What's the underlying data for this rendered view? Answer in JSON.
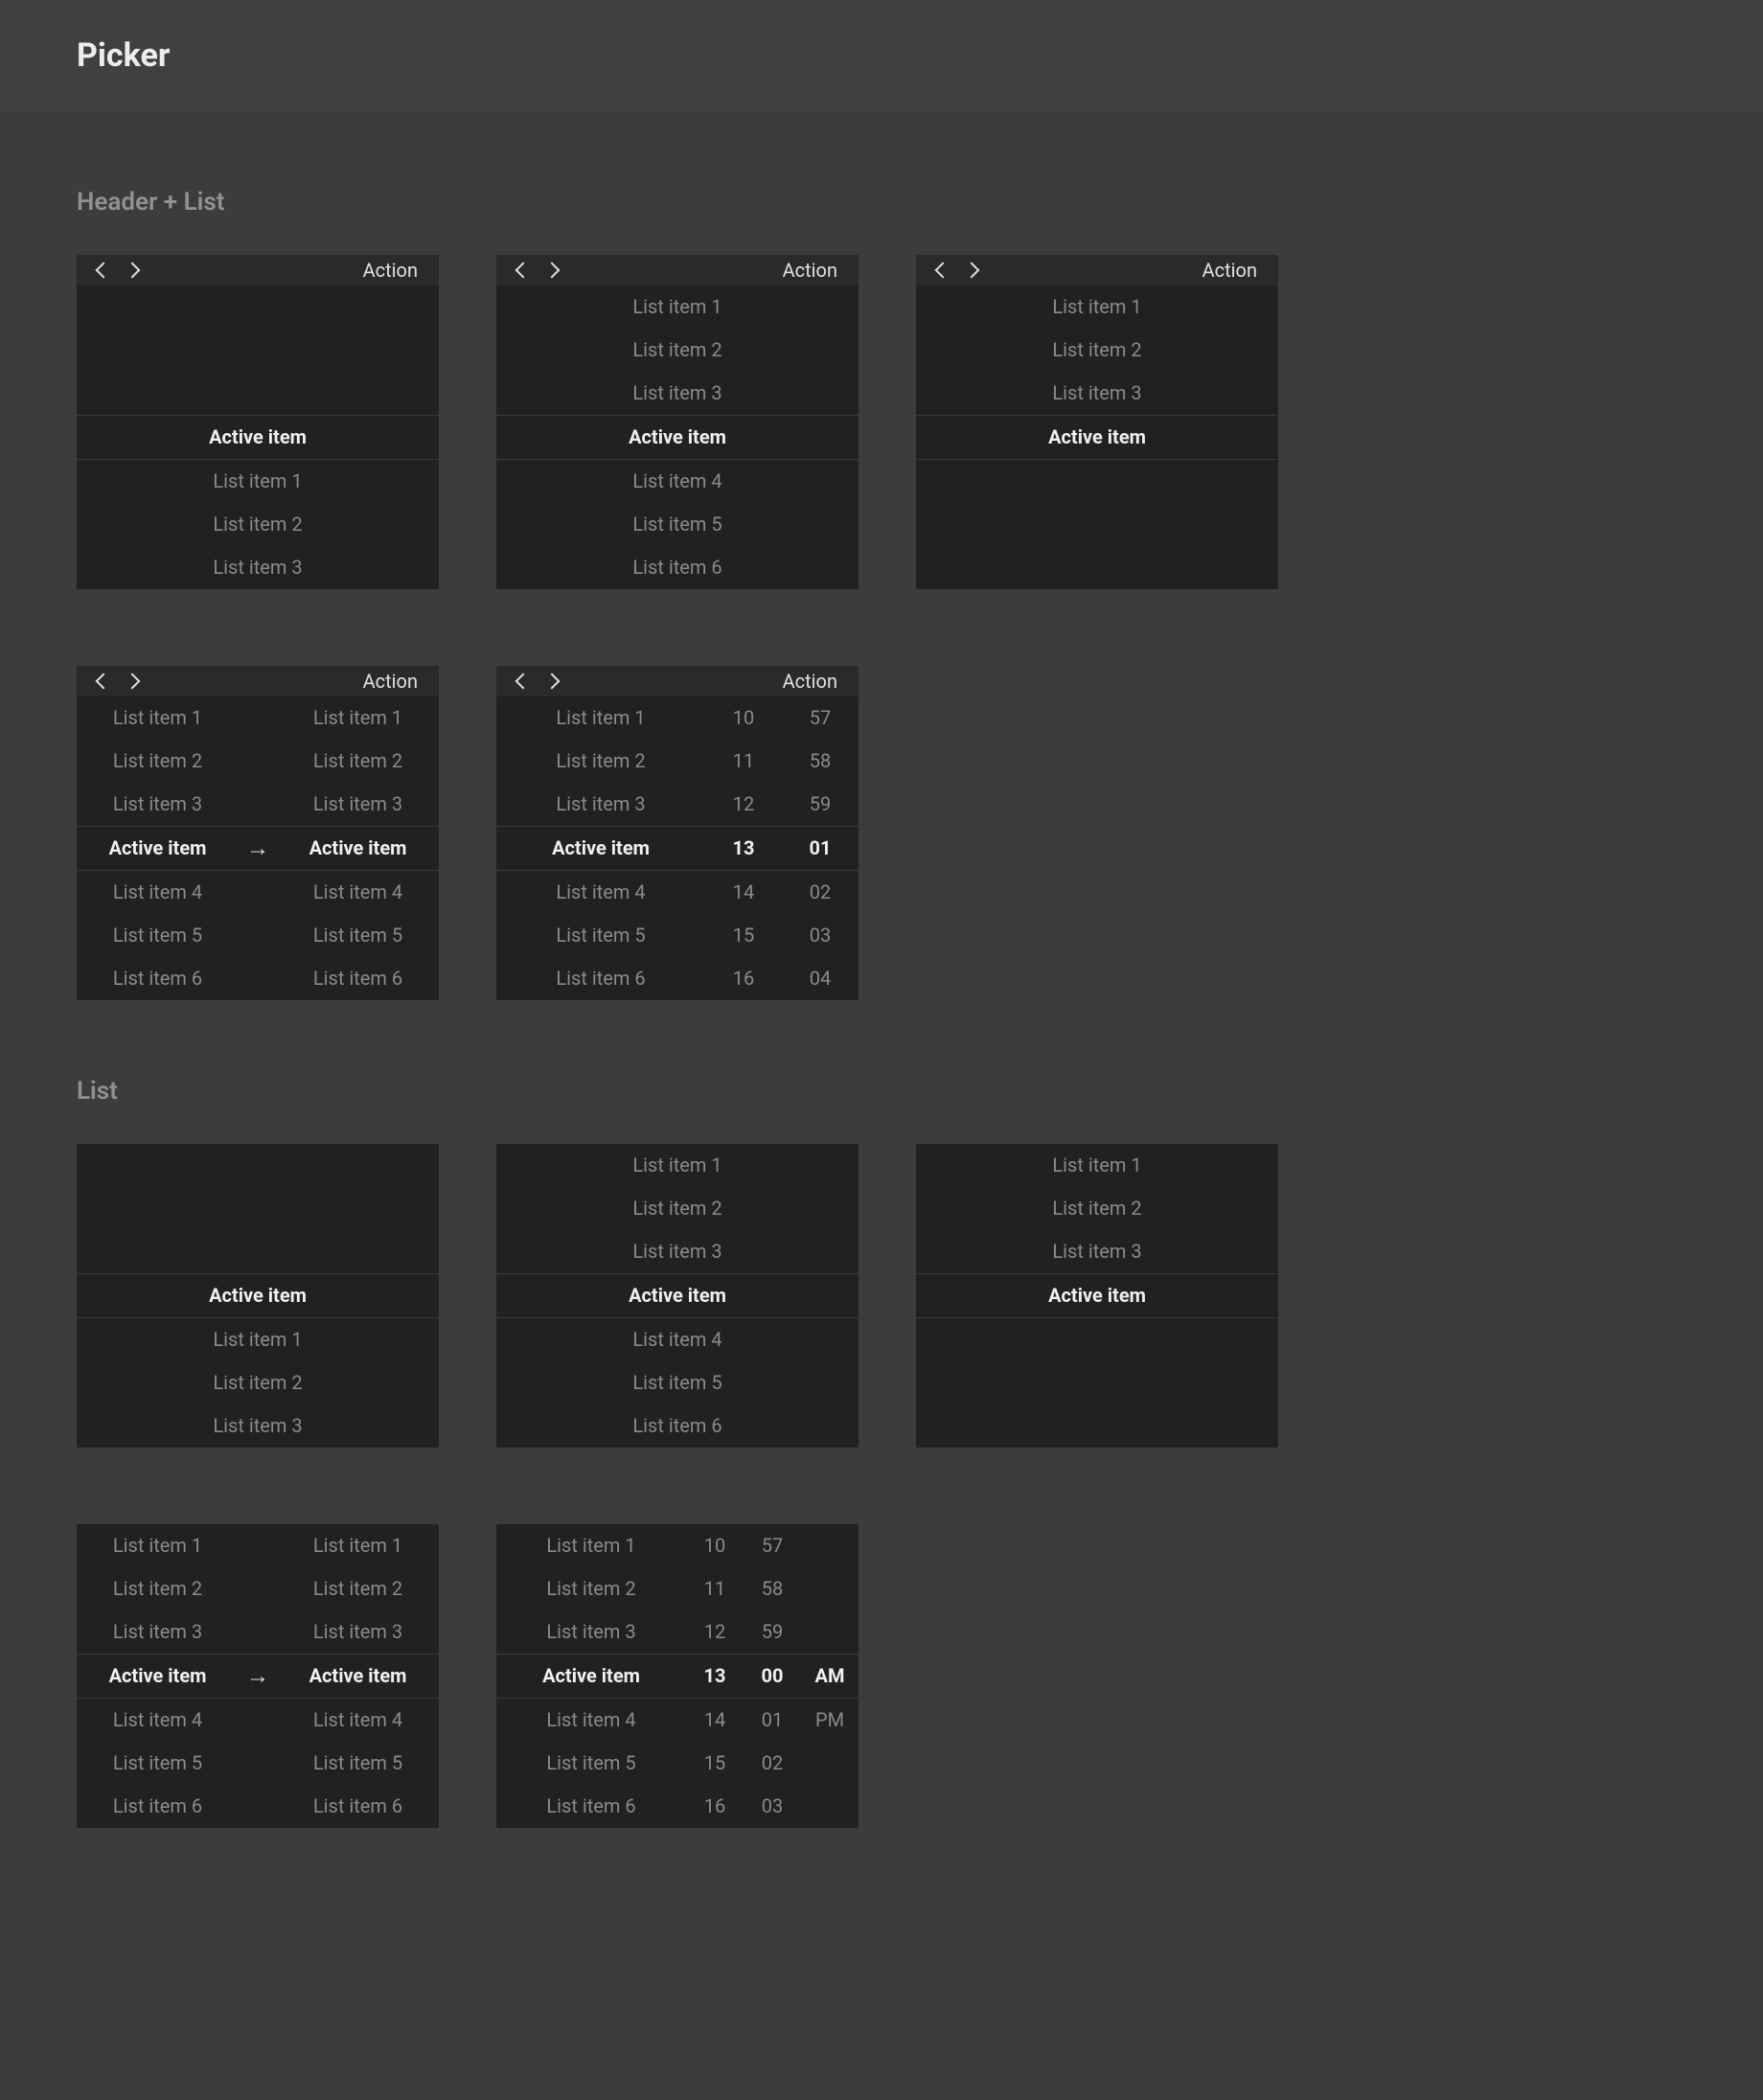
{
  "title": "Picker",
  "section1": "Header + List",
  "section2": "List",
  "header": {
    "action": "Action"
  },
  "items": {
    "li1": "List item 1",
    "li2": "List item 2",
    "li3": "List item 3",
    "li4": "List item 4",
    "li5": "List item 5",
    "li6": "List item 6",
    "active": "Active item"
  },
  "nums": {
    "h10": "10",
    "h11": "11",
    "h12": "12",
    "h13": "13",
    "h14": "14",
    "h15": "15",
    "h16": "16",
    "m57": "57",
    "m58": "58",
    "m59": "59",
    "m00": "00",
    "m01": "01",
    "m02": "02",
    "m03": "03",
    "m04": "04",
    "am": "AM",
    "pm": "PM"
  }
}
